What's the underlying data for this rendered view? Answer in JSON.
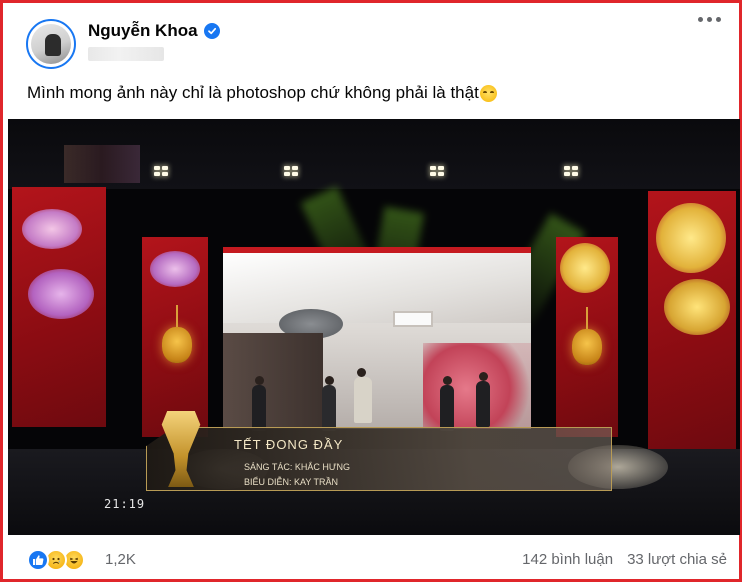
{
  "post": {
    "author": "Nguyễn Khoa",
    "verified": true,
    "caption": "Mình mong ảnh này chỉ là photoshop chứ không phải là thật",
    "caption_emoji": "sleepy-face",
    "more_icon": "more-horizontal-icon"
  },
  "photo": {
    "lower_third": {
      "title": "TẾT ĐONG ĐẦY",
      "line1": "SÁNG TÁC: KHẮC HƯNG",
      "line2": "BIỂU DIỄN: KAY TRẦN"
    },
    "clock": "21:19"
  },
  "footer": {
    "reactions": [
      "like",
      "sad",
      "haha"
    ],
    "reaction_count": "1,2K",
    "comments": "142 bình luận",
    "shares": "33 lượt chia sẻ"
  },
  "colors": {
    "border": "#e0262b",
    "accent": "#1877f2",
    "muted_text": "#65676b"
  }
}
